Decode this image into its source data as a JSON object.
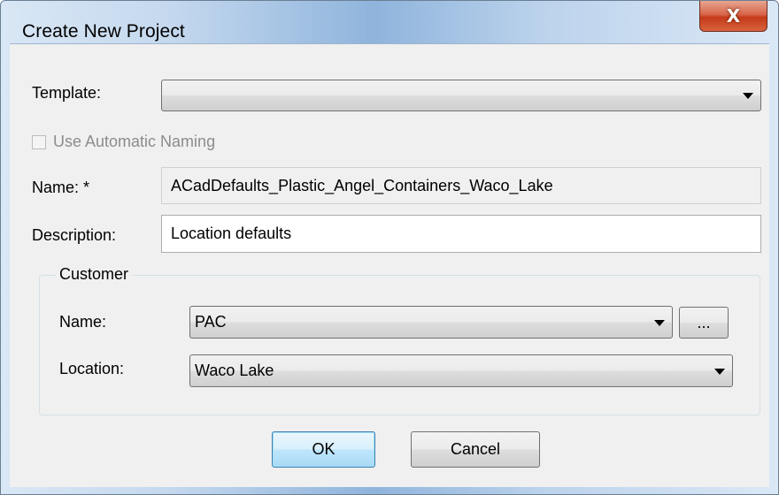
{
  "window": {
    "title": "Create New Project",
    "close_glyph": "X"
  },
  "form": {
    "template": {
      "label": "Template:",
      "value": ""
    },
    "auto_naming": {
      "label": "Use Automatic Naming",
      "checked": false,
      "enabled": false
    },
    "name": {
      "label": "Name:  *",
      "value": "ACadDefaults_Plastic_Angel_Containers_Waco_Lake"
    },
    "description": {
      "label": "Description:",
      "value": "Location defaults"
    },
    "customer": {
      "group_label": "Customer",
      "name_label": "Name:",
      "name_value": "PAC",
      "browse_label": "...",
      "location_label": "Location:",
      "location_value": "Waco Lake"
    }
  },
  "buttons": {
    "ok": "OK",
    "cancel": "Cancel"
  },
  "icons": {
    "close": "close-icon",
    "dropdown": "chevron-down-icon"
  },
  "colors": {
    "close_button": "#c53a18",
    "default_button_border": "#3c7fb1",
    "dialog_background": "#f0f0f0"
  }
}
